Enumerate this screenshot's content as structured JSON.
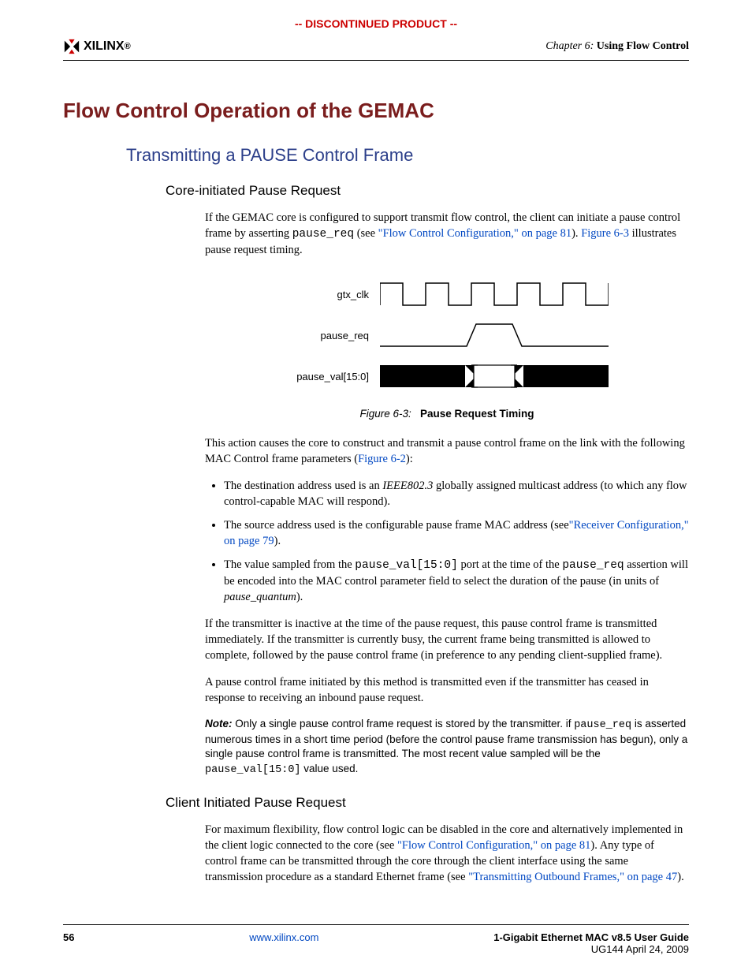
{
  "banner": "-- DISCONTINUED PRODUCT --",
  "header": {
    "logo_text": "XILINX",
    "chapter_prefix": "Chapter 6:",
    "chapter_title": "Using Flow Control"
  },
  "h1": "Flow Control Operation of the GEMAC",
  "h2": "Transmitting a PAUSE Control Frame",
  "h3a": "Core-initiated Pause Request",
  "p1_a": "If the GEMAC core is configured to support transmit flow control, the client can initiate a pause control frame by asserting ",
  "p1_mono": "pause_req",
  "p1_b": " (see ",
  "p1_link": "\"Flow Control Configuration,\" on page 81",
  "p1_c": "). ",
  "p1_link2": "Figure 6-3",
  "p1_d": " illustrates pause request timing.",
  "timing": {
    "r1": "gtx_clk",
    "r2": "pause_req",
    "r3": "pause_val[15:0]"
  },
  "fig_caption_i": "Figure 6-3:",
  "fig_caption_b": "Pause Request Timing",
  "p2_a": "This action causes the core to construct and transmit a pause control frame on the link with the following MAC Control frame parameters (",
  "p2_link": "Figure 6-2",
  "p2_b": "):",
  "li1_a": "The destination address used is an ",
  "li1_em": "IEEE802.3",
  "li1_b": " globally assigned multicast address (to which any flow control-capable MAC will respond).",
  "li2_a": "The source address used is the configurable pause frame MAC address (see",
  "li2_link": "\"Receiver Configuration,\" on page 79",
  "li2_b": ").",
  "li3_a": "The value sampled from the ",
  "li3_m1": "pause_val[15:0]",
  "li3_b": " port at the time of the ",
  "li3_m2": "pause_req",
  "li3_c": " assertion will be encoded into the MAC control parameter field to select the duration of the pause (in units of ",
  "li3_em": "pause_quantum",
  "li3_d": ").",
  "p3": "If the transmitter is inactive at the time of the pause request, this pause control frame is transmitted immediately. If the transmitter is currently busy, the current frame being transmitted is allowed to complete, followed by the pause control frame (in preference to any pending client-supplied frame).",
  "p4": "A pause control frame initiated by this method is transmitted even if the transmitter has ceased in response to receiving an inbound pause request.",
  "note_label": "Note:",
  "note_a": " Only a single pause control frame request is stored by the transmitter. if ",
  "note_m1": "pause_req",
  "note_b": " is asserted numerous times in a short time period (before the control pause frame transmission has begun), only a single pause control frame is transmitted. The most recent value sampled will be the ",
  "note_m2": "pause_val[15:0]",
  "note_c": " value used.",
  "h3b": "Client Initiated Pause Request",
  "p5_a": "For maximum flexibility, flow control logic can be disabled in the core and alternatively implemented in the client logic connected to the core (see ",
  "p5_link1": "\"Flow Control Configuration,\" on page 81",
  "p5_b": "). Any type of control frame can be transmitted through the core through the client interface using the same transmission procedure as a standard Ethernet frame (see ",
  "p5_link2": "\"Transmitting Outbound Frames,\" on page 47",
  "p5_c": ").",
  "footer": {
    "page": "56",
    "url": "www.xilinx.com",
    "title": "1-Gigabit Ethernet MAC v8.5 User Guide",
    "docid": "UG144 April 24, 2009"
  }
}
